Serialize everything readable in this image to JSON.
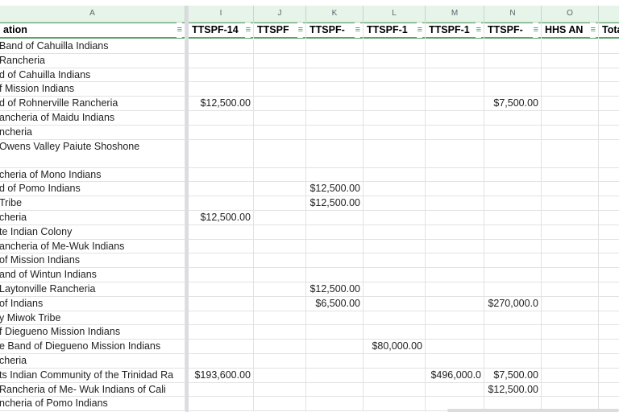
{
  "column_letters": [
    "A",
    "I",
    "J",
    "K",
    "L",
    "M",
    "N",
    "O",
    ""
  ],
  "headers": [
    "ation",
    "TTSPF-14",
    "TTSPF",
    "TTSPF-",
    "TTSPF-1",
    "TTSPF-1",
    "TTSPF-",
    "HHS AN",
    "Tota"
  ],
  "rows": [
    {
      "name": "Band of Cahuilla Indians",
      "I": "",
      "J": "",
      "K": "",
      "L": "",
      "M": "",
      "N": "",
      "O": ""
    },
    {
      "name": "Rancheria",
      "I": "",
      "J": "",
      "K": "",
      "L": "",
      "M": "",
      "N": "",
      "O": ""
    },
    {
      "name": "d of Cahuilla Indians",
      "I": "",
      "J": "",
      "K": "",
      "L": "",
      "M": "",
      "N": "",
      "O": ""
    },
    {
      "name": "f Mission Indians",
      "I": "",
      "J": "",
      "K": "",
      "L": "",
      "M": "",
      "N": "",
      "O": ""
    },
    {
      "name": "d of Rohnerville Rancheria",
      "I": "$12,500.00",
      "J": "",
      "K": "",
      "L": "",
      "M": "",
      "N": "$7,500.00",
      "O": ""
    },
    {
      "name": "ancheria of Maidu Indians",
      "I": "",
      "J": "",
      "K": "",
      "L": "",
      "M": "",
      "N": "",
      "O": ""
    },
    {
      "name": "ncheria",
      "I": "",
      "J": "",
      "K": "",
      "L": "",
      "M": "",
      "N": "",
      "O": ""
    },
    {
      "name": "Owens Valley Paiute Shoshone",
      "I": "",
      "J": "",
      "K": "",
      "L": "",
      "M": "",
      "N": "",
      "O": "",
      "tall": true
    },
    {
      "name": "cheria of Mono Indians",
      "I": "",
      "J": "",
      "K": "",
      "L": "",
      "M": "",
      "N": "",
      "O": ""
    },
    {
      "name": "d of Pomo Indians",
      "I": "",
      "J": "",
      "K": "$12,500.00",
      "L": "",
      "M": "",
      "N": "",
      "O": ""
    },
    {
      "name": "Tribe",
      "I": "",
      "J": "",
      "K": "$12,500.00",
      "L": "",
      "M": "",
      "N": "",
      "O": ""
    },
    {
      "name": "cheria",
      "I": "$12,500.00",
      "J": "",
      "K": "",
      "L": "",
      "M": "",
      "N": "",
      "O": ""
    },
    {
      "name": "te Indian Colony",
      "I": "",
      "J": "",
      "K": "",
      "L": "",
      "M": "",
      "N": "",
      "O": ""
    },
    {
      "name": "ancheria of Me-Wuk Indians",
      "I": "",
      "J": "",
      "K": "",
      "L": "",
      "M": "",
      "N": "",
      "O": ""
    },
    {
      "name": " of Mission Indians",
      "I": "",
      "J": "",
      "K": "",
      "L": "",
      "M": "",
      "N": "",
      "O": ""
    },
    {
      "name": "and of Wintun Indians",
      "I": "",
      "J": "",
      "K": "",
      "L": "",
      "M": "",
      "N": "",
      "O": ""
    },
    {
      "name": "Laytonville Rancheria",
      "I": "",
      "J": "",
      "K": "$12,500.00",
      "L": "",
      "M": "",
      "N": "",
      "O": ""
    },
    {
      "name": "of Indians",
      "I": "",
      "J": "",
      "K": "$6,500.00",
      "L": "",
      "M": "",
      "N": "$270,000.0",
      "O": ""
    },
    {
      "name": "y Miwok Tribe",
      "I": "",
      "J": "",
      "K": "",
      "L": "",
      "M": "",
      "N": "",
      "O": ""
    },
    {
      "name": "f Diegueno Mission Indians",
      "I": "",
      "J": "",
      "K": "",
      "L": "",
      "M": "",
      "N": "",
      "O": ""
    },
    {
      "name": "e Band of Diegueno Mission Indians",
      "I": "",
      "J": "",
      "K": "",
      "L": "$80,000.00",
      "M": "",
      "N": "",
      "O": ""
    },
    {
      "name": "cheria",
      "I": "",
      "J": "",
      "K": "",
      "L": "",
      "M": "",
      "N": "",
      "O": ""
    },
    {
      "name": "ts Indian Community of the Trinidad Ra",
      "I": "$193,600.00",
      "J": "",
      "K": "",
      "L": "",
      "M": "$496,000.0",
      "N": "$7,500.00",
      "O": ""
    },
    {
      "name": " Rancheria of Me- Wuk Indians of Cali",
      "I": "",
      "J": "",
      "K": "",
      "L": "",
      "M": "",
      "N": "$12,500.00",
      "O": ""
    },
    {
      "name": "ncheria of Pomo Indians",
      "I": "",
      "J": "",
      "K": "",
      "L": "",
      "M": "",
      "N": "",
      "O": ""
    }
  ],
  "colors": {
    "header_bg": "#e6f4ea",
    "filter_green": "#3a9b5b",
    "grid": "#e2e2e2"
  }
}
